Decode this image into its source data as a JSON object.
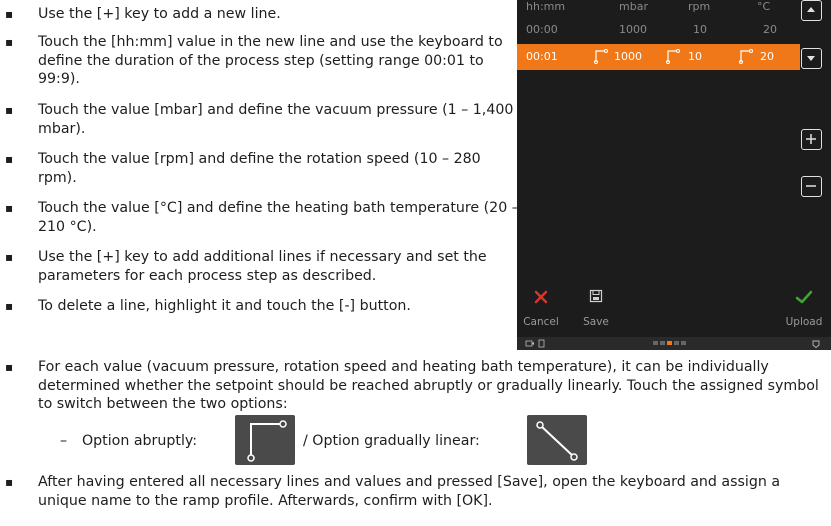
{
  "instructions": [
    {
      "text": "Use the [+] key to add a new line."
    },
    {
      "text": "Touch the [hh:mm] value in the new line and use the keyboard to define the duration of the process step (setting range 00:01 to 99:9)."
    },
    {
      "text": "Touch the value [mbar] and define the vacuum pressure (1 – 1,400 mbar)."
    },
    {
      "text": "Touch the value [rpm] and define the rotation speed (10 – 280 rpm)."
    },
    {
      "text": "Touch the value [°C] and define the heating bath temperature (20 – 210 °C)."
    },
    {
      "text": "Use the [+] key to add additional lines if necessary and set the parameters for each process step as described."
    },
    {
      "text": "To delete a line, highlight it and touch the [-] button."
    }
  ],
  "bullet_symbol": "▪",
  "bottom": {
    "switch_text": "For each value (vacuum pressure, rotation speed and heating bath temperature), it can be individually determined whether the setpoint should be reached abruptly or gradually linearly. Touch the assigned symbol to switch between the two options:",
    "option_dash": "–",
    "option_abrupt_label": "Option abruptly:",
    "option_linear_label": "/ Option gradually linear:",
    "save_text": "After having entered all necessary lines and values and pressed [Save], open the keyboard and assign a unique name to the ramp profile. Afterwards, confirm with [OK]."
  },
  "device": {
    "columns": [
      "hh:mm",
      "mbar",
      "rpm",
      "°C"
    ],
    "rows": [
      {
        "time": "00:00",
        "mbar": "1000",
        "rpm": "10",
        "temp": "20",
        "selected": false
      },
      {
        "time": "00:01",
        "mbar": "1000",
        "rpm": "10",
        "temp": "20",
        "selected": true
      }
    ],
    "actions": {
      "cancel": "Cancel",
      "save": "Save",
      "upload": "Upload"
    },
    "colors": {
      "selected_row": "#f07818",
      "cancel": "#d9342b",
      "upload": "#3fa535",
      "background": "#1c1c1c"
    }
  }
}
